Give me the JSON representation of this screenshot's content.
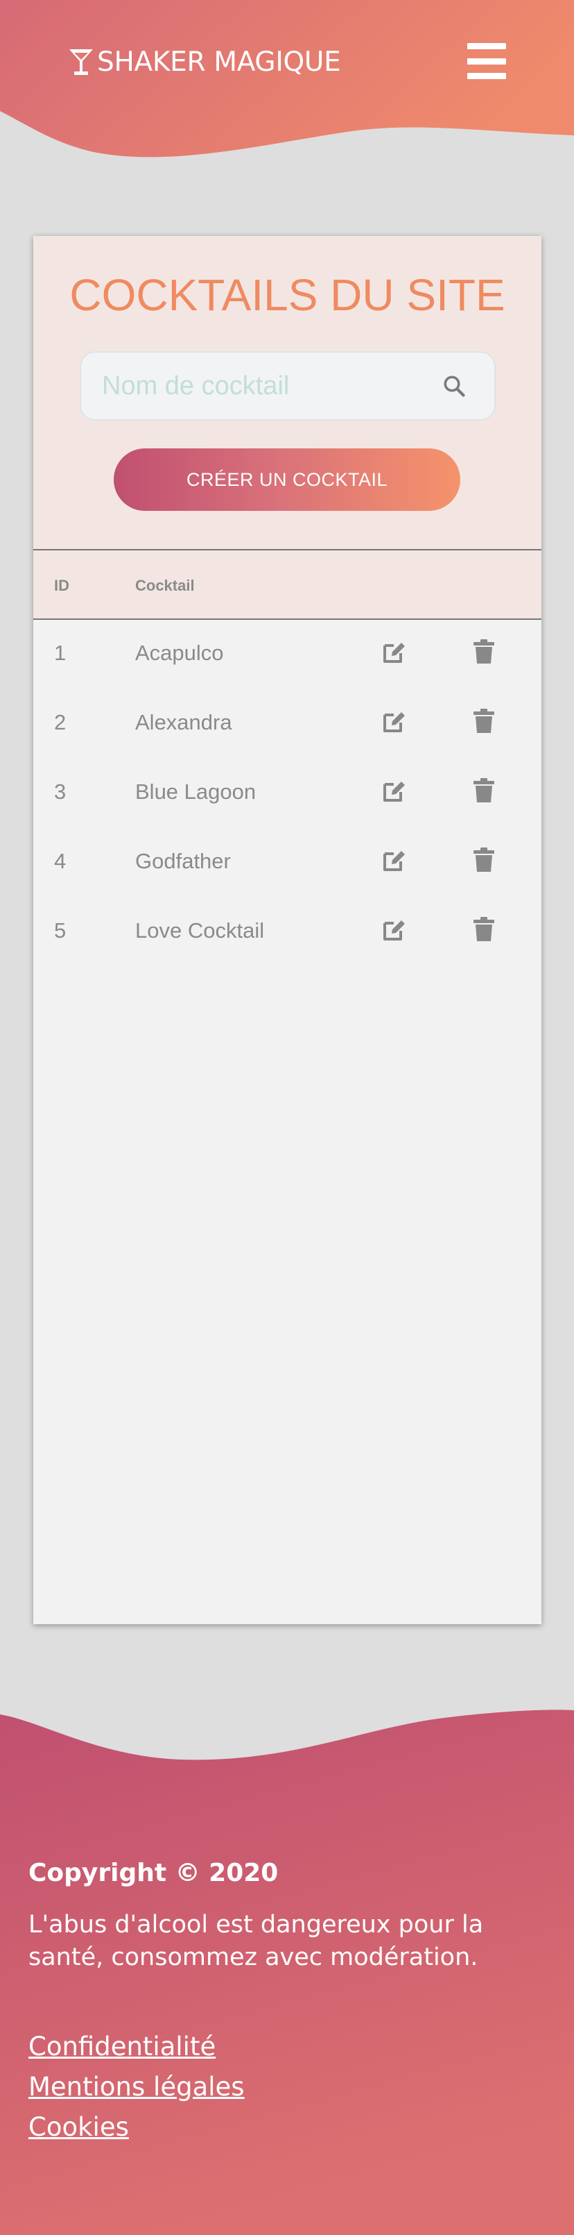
{
  "header": {
    "brand": "SHAKER MAGIQUE",
    "logo_icon": "cocktail-glass-icon",
    "menu_icon": "hamburger-menu-icon"
  },
  "main": {
    "title": "COCKTAILS DU SITE",
    "search": {
      "value": "",
      "placeholder": "Nom de cocktail",
      "icon": "search-icon"
    },
    "create_label": "CRÉER UN COCKTAIL",
    "table": {
      "headers": {
        "id": "ID",
        "name": "Cocktail"
      },
      "rows": [
        {
          "id": "1",
          "name": "Acapulco"
        },
        {
          "id": "2",
          "name": "Alexandra"
        },
        {
          "id": "3",
          "name": "Blue Lagoon"
        },
        {
          "id": "4",
          "name": "Godfather"
        },
        {
          "id": "5",
          "name": "Love Cocktail"
        }
      ],
      "row_icons": [
        "edit-icon",
        "trash-icon"
      ]
    }
  },
  "footer": {
    "copyright": "Copyright © 2020",
    "disclaimer": "L'abus d'alcool est dangereux pour la santé, consommez avec modération.",
    "links": [
      "Confidentialité",
      "Mentions légales",
      "Cookies"
    ]
  },
  "colors": {
    "header_gradient": [
      "#d66a76",
      "#ef8a6c"
    ],
    "footer_gradient": [
      "#c05070",
      "#dc7070"
    ],
    "title": "#f08a60",
    "card_tint": "#f3e6e2",
    "page_bg": "#dedede"
  }
}
